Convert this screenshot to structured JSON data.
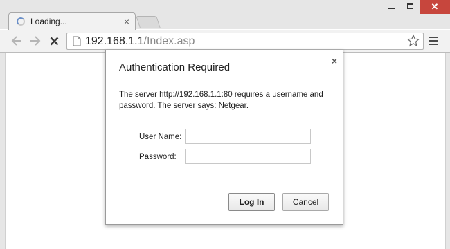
{
  "window": {
    "minimize_label": "minimize",
    "maximize_label": "maximize",
    "close_glyph": "✕"
  },
  "tab": {
    "title": "Loading...",
    "close_glyph": "×",
    "icon": "loading-spinner-icon"
  },
  "toolbar": {
    "back_icon": "back-arrow-icon",
    "forward_icon": "forward-arrow-icon",
    "stop_icon": "stop-icon",
    "menu_icon": "hamburger-menu-icon"
  },
  "address": {
    "host": "192.168.1.1",
    "path": "/Index.asp",
    "page_icon": "page-icon",
    "bookmark_icon": "star-icon"
  },
  "dialog": {
    "title": "Authentication Required",
    "close_glyph": "×",
    "message": "The server http://192.168.1.1:80 requires a username and password. The server says: Netgear.",
    "username_label": "User Name:",
    "username_value": "",
    "password_label": "Password:",
    "password_value": "",
    "login_label": "Log In",
    "cancel_label": "Cancel"
  },
  "colors": {
    "chrome_bg": "#e6e6e6",
    "toolbar_bg": "#f2f2f2",
    "close_button": "#c7463d",
    "url_host": "#222222",
    "url_path": "#888888"
  }
}
